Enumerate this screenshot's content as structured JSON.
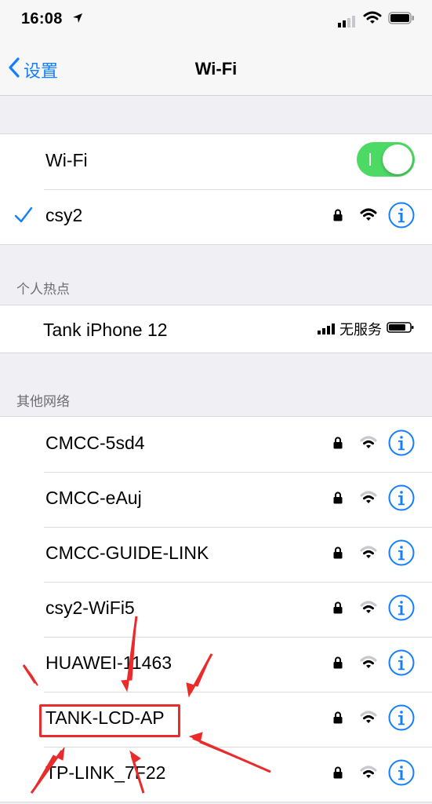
{
  "status_bar": {
    "time": "16:08"
  },
  "nav": {
    "back_label": "设置",
    "title": "Wi-Fi"
  },
  "wifi_toggle": {
    "label": "Wi-Fi",
    "state": "on"
  },
  "connected_network": {
    "name": "csy2",
    "secured": true
  },
  "hotspot_section": {
    "header": "个人热点",
    "device": {
      "name": "Tank iPhone 12",
      "status": "无服务"
    }
  },
  "other_networks": {
    "header": "其他网络",
    "items": [
      {
        "name": "CMCC-5sd4",
        "secured": true
      },
      {
        "name": "CMCC-eAuj",
        "secured": true
      },
      {
        "name": "CMCC-GUIDE-LINK",
        "secured": true
      },
      {
        "name": "csy2-WiFi5",
        "secured": true
      },
      {
        "name": "HUAWEI-11463",
        "secured": true
      },
      {
        "name": "TANK-LCD-AP",
        "secured": true,
        "highlighted": true
      },
      {
        "name": "TP-LINK_7F22",
        "secured": true
      }
    ]
  },
  "colors": {
    "accent": "#157efb",
    "toggle_on": "#4cd964",
    "annotation": "#ea2b2b"
  }
}
